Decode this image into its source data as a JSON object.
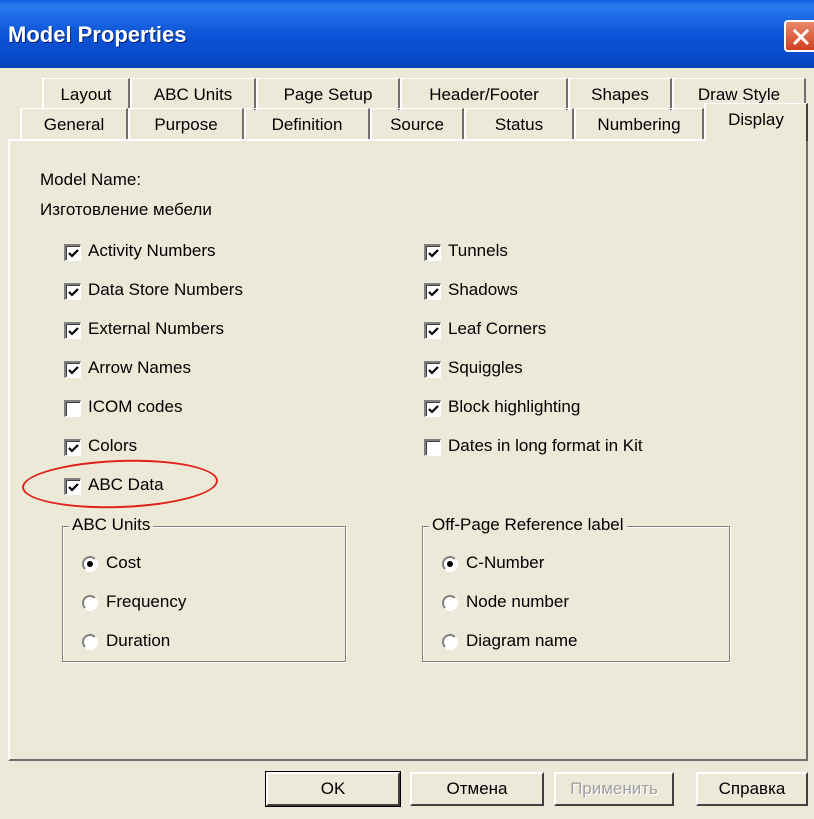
{
  "window": {
    "title": "Model Properties"
  },
  "tabs": {
    "row1": [
      "Layout",
      "ABC Units",
      "Page Setup",
      "Header/Footer",
      "Shapes",
      "Draw Style"
    ],
    "row2": [
      "General",
      "Purpose",
      "Definition",
      "Source",
      "Status",
      "Numbering",
      "Display"
    ],
    "active": "Display"
  },
  "display": {
    "model_name_label": "Model Name:",
    "model_name_value": "Изготовление мебели",
    "checkboxes_left": [
      {
        "label": "Activity Numbers",
        "checked": true
      },
      {
        "label": "Data Store Numbers",
        "checked": true
      },
      {
        "label": "External Numbers",
        "checked": true
      },
      {
        "label": "Arrow Names",
        "checked": true
      },
      {
        "label": "ICOM codes",
        "checked": false
      },
      {
        "label": "Colors",
        "checked": true
      },
      {
        "label": "ABC Data",
        "checked": true
      }
    ],
    "checkboxes_right": [
      {
        "label": "Tunnels",
        "checked": true
      },
      {
        "label": "Shadows",
        "checked": true
      },
      {
        "label": "Leaf Corners",
        "checked": true
      },
      {
        "label": "Squiggles",
        "checked": true
      },
      {
        "label": "Block highlighting",
        "checked": true
      },
      {
        "label": "Dates in long format in Kit",
        "checked": false
      }
    ],
    "abc_units": {
      "title": "ABC Units",
      "options": [
        "Cost",
        "Frequency",
        "Duration"
      ],
      "selected": "Cost"
    },
    "off_page": {
      "title": "Off-Page Reference label",
      "options": [
        "C-Number",
        "Node number",
        "Diagram name"
      ],
      "selected": "C-Number"
    }
  },
  "buttons": {
    "ok": "OK",
    "cancel": "Отмена",
    "apply": "Применить",
    "help": "Справка"
  },
  "colors": {
    "title_bar": "#0C54D8",
    "highlight": "#E0201A",
    "dialog_bg": "#ECE9D8"
  }
}
